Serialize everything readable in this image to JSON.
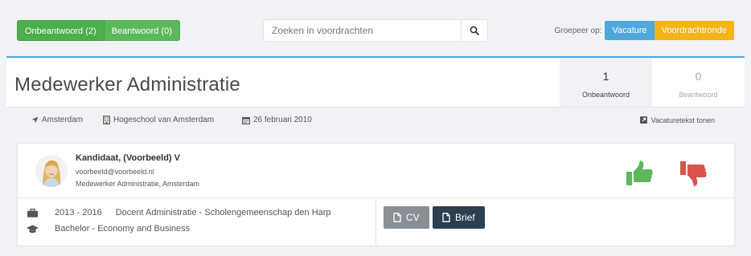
{
  "filter_tabs": [
    {
      "label": "Onbeantwoord (2)"
    },
    {
      "label": "Beantwoord (0)"
    }
  ],
  "search": {
    "placeholder": "Zoeken in voordrachten",
    "icon": "search-icon"
  },
  "grouping": {
    "label": "Groepeer op:",
    "options": [
      "Vacature",
      "Voordrachtronde"
    ],
    "colors": {
      "vacature": "#4fa8dd",
      "voordrachtronde": "#f5b417"
    }
  },
  "vacancy": {
    "title": "Medewerker Administratie",
    "stats": [
      {
        "count": "1",
        "label": "Onbeantwoord"
      },
      {
        "count": "0",
        "label": "Beantwoord"
      }
    ],
    "location": "Amsterdam",
    "organisation": "Hogeschool van Amsterdam",
    "date": "26 februari 2010",
    "show_text_link": "Vacaturetekst tonen",
    "accent_color": "#4fa8dd"
  },
  "candidate": {
    "name": "Kandidaat, (Voorbeeld) V",
    "email": "voorbeeld@voorbeeld.nl",
    "job": "Medewerker Administratie, Amsterdam",
    "experience": {
      "period": "2013 - 2016",
      "description": "Docent Administratie - Scholengemeenschap den Harp"
    },
    "education": "Bachelor - Economy and Business",
    "buttons": {
      "cv": "CV",
      "brief": "Brief"
    },
    "approve_color": "#5cb85c",
    "reject_color": "#d9534f"
  }
}
